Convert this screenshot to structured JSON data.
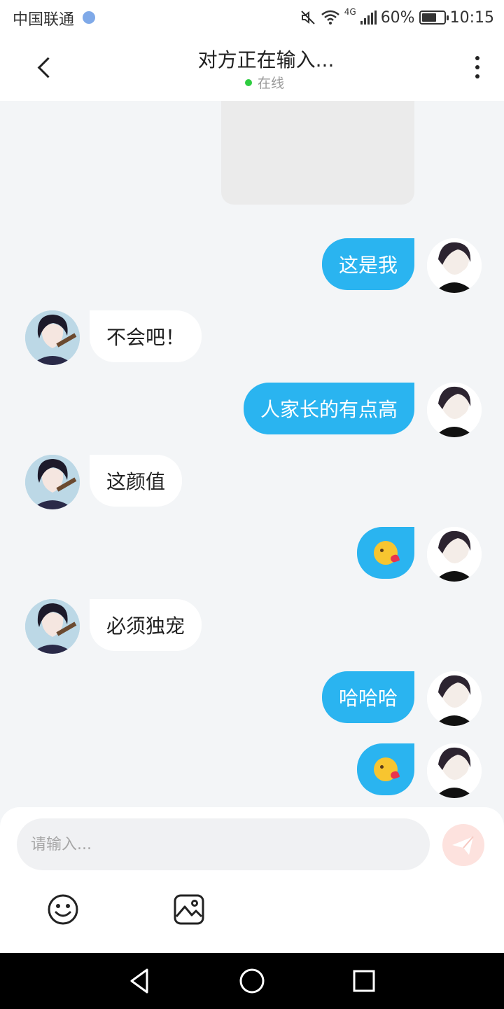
{
  "status_bar": {
    "carrier": "中国联通",
    "network": "4G",
    "battery": "60%",
    "time": "10:15"
  },
  "header": {
    "title": "对方正在输入...",
    "presence": "在线"
  },
  "messages": [
    {
      "side": "self",
      "text": "这是我"
    },
    {
      "side": "peer",
      "text": "不会吧！"
    },
    {
      "side": "self",
      "text": "人家长的有点高"
    },
    {
      "side": "peer",
      "text": "这颜值"
    },
    {
      "side": "self",
      "emoji": "kiss-emoji"
    },
    {
      "side": "peer",
      "text": "必须独宠"
    },
    {
      "side": "self",
      "text": "哈哈哈"
    },
    {
      "side": "self",
      "emoji": "kiss-emoji"
    }
  ],
  "composer": {
    "placeholder": "请输入..."
  },
  "colors": {
    "self_bubble": "#2ab4f0",
    "peer_bubble": "#ffffff",
    "online": "#2ecc40",
    "send_button": "#fde2de"
  },
  "icons": {
    "back": "back-arrow-icon",
    "more": "more-vertical-icon",
    "send": "send-paper-plane-icon",
    "emoji": "smiley-icon",
    "image": "image-icon",
    "nav_back": "triangle-back-icon",
    "nav_home": "circle-home-icon",
    "nav_recent": "square-recents-icon"
  }
}
